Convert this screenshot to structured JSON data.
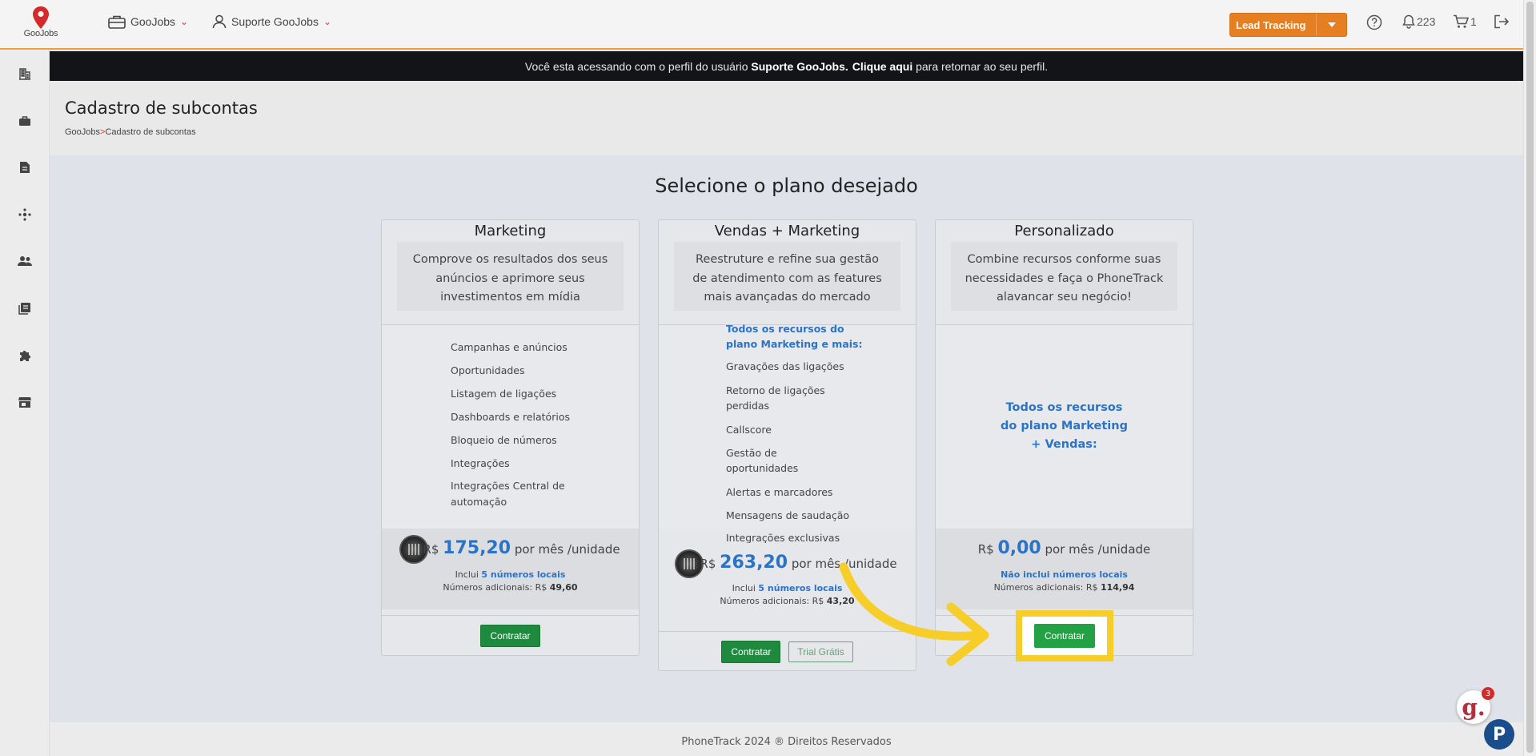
{
  "topbar": {
    "logo_text": "GooJobs",
    "nav_company": "GooJobs",
    "nav_user": "Suporte GooJobs",
    "lead_tracking_label": "Lead Tracking",
    "notifications_count": "223",
    "cart_count": "1"
  },
  "banner": {
    "prefix": "Você esta acessando com o perfil do usuário ",
    "user": "Suporte GooJobs.",
    "link": "Clique aqui",
    "suffix": " para retornar ao seu perfil."
  },
  "page": {
    "title": "Cadastro de subcontas",
    "breadcrumb_root": "GooJobs",
    "breadcrumb_sep": ">",
    "breadcrumb_current": "Cadastro de subcontas",
    "heading": "Selecione o plano desejado"
  },
  "plans": [
    {
      "name": "Marketing",
      "desc": [
        "Comprove os resultados dos seus",
        "anúncios e aprimore seus",
        "investimentos em mídia"
      ],
      "features": [
        "Campanhas e anúncios",
        "Oportunidades",
        "Listagem de ligações",
        "Dashboards e relatórios",
        "Bloqueio de números",
        "Integrações",
        "Integrações Central de",
        "automação"
      ],
      "currency": "R$",
      "price": "175,20",
      "period": "por mês /unidade",
      "includes_prefix": "Inclui ",
      "includes_link": "5 números locais",
      "additional_label": "Números adicionais: R$ ",
      "additional_value": "49,60",
      "button": "Contratar"
    },
    {
      "name": "Vendas + Marketing",
      "desc": [
        "Reestruture e refine sua gestão",
        "de atendimento com as features",
        "mais avançadas do mercado"
      ],
      "features_title": [
        "Todos os recursos do",
        "plano Marketing e mais:"
      ],
      "features": [
        "Gravações das ligações",
        "Retorno de ligações",
        "perdidas",
        "Callscore",
        "Gestão de",
        "oportunidades",
        "Alertas e marcadores",
        "Mensagens de saudação",
        "Integrações exclusivas"
      ],
      "currency": "R$",
      "price": "263,20",
      "period": "por mês /unidade",
      "includes_prefix": "Inclui ",
      "includes_link": "5 números locais",
      "additional_label": "Números adicionais: R$ ",
      "additional_value": "43,20",
      "button": "Contratar",
      "trial_button": "Trial Grátis"
    },
    {
      "name": "Personalizado",
      "desc": [
        "Combine recursos conforme suas",
        "necessidades e faça o PhoneTrack",
        "alavancar seu negócio!"
      ],
      "features_title": [
        "Todos os recursos",
        "do plano Marketing",
        "+ Vendas:"
      ],
      "currency": "R$",
      "price": "0,00",
      "period": "por mês /unidade",
      "includes_link": "Não inclui números locais",
      "additional_label": "Números adicionais: R$ ",
      "additional_value": "114,94",
      "button": "Contratar"
    }
  ],
  "footer": "PhoneTrack 2024 ® Direitos Reservados",
  "widgets": {
    "chat_badge": "3",
    "chat_letter": "g.",
    "phonetrack_letter": "P"
  },
  "colors": {
    "accent": "#e67e22",
    "primary_blue": "#2a73c7",
    "button_green": "#1e8a3e",
    "highlight": "#f7cd2a"
  }
}
